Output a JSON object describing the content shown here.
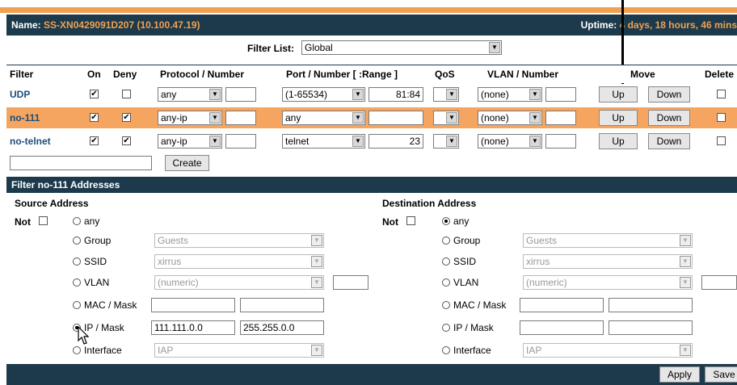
{
  "header": {
    "name_label": "Name:",
    "name_value": "SS-XN0429091D207",
    "ip_value": "(10.100.47.19)",
    "uptime_label": "Uptime:",
    "uptime_value": "4 days, 18 hours, 46 mins"
  },
  "filter_list": {
    "label": "Filter List:",
    "value": "Global"
  },
  "columns": {
    "filter": "Filter",
    "on": "On",
    "deny": "Deny",
    "protocol": "Protocol / Number",
    "port": "Port / Number [ :Range ]",
    "qos": "QoS",
    "vlan": "VLAN / Number",
    "move": "Move",
    "delete": "Delete"
  },
  "rows": [
    {
      "name": "UDP",
      "on": true,
      "deny": false,
      "protocol": "any",
      "protocol_num": "",
      "port": "(1-65534)",
      "port_num": "81:84",
      "qos": "",
      "vlan": "(none)",
      "vlan_num": "",
      "up": "Up",
      "down": "Down",
      "highlight": false
    },
    {
      "name": "no-111",
      "on": true,
      "deny": true,
      "protocol": "any-ip",
      "protocol_num": "",
      "port": "any",
      "port_num": "",
      "qos": "",
      "vlan": "(none)",
      "vlan_num": "",
      "up": "Up",
      "down": "Down",
      "highlight": true
    },
    {
      "name": "no-telnet",
      "on": true,
      "deny": true,
      "protocol": "any-ip",
      "protocol_num": "",
      "port": "telnet",
      "port_num": "23",
      "qos": "",
      "vlan": "(none)",
      "vlan_num": "",
      "up": "Up",
      "down": "Down",
      "highlight": false
    }
  ],
  "create": {
    "value": "",
    "button": "Create"
  },
  "addresses": {
    "title": "Filter no-111  Addresses",
    "source": {
      "heading": "Source Address",
      "not_label": "Not",
      "options": {
        "any": "any",
        "group": "Group",
        "ssid": "SSID",
        "vlan": "VLAN",
        "mac": "MAC / Mask",
        "ip": "IP / Mask",
        "iface": "Interface"
      },
      "selected": "ip",
      "group_value": "Guests",
      "ssid_value": "xirrus",
      "vlan_value": "(numeric)",
      "vlan_num": "",
      "mac_value": "",
      "mac_mask": "",
      "ip_value": "111.111.0.0",
      "ip_mask": "255.255.0.0",
      "iface_value": "IAP"
    },
    "destination": {
      "heading": "Destination Address",
      "not_label": "Not",
      "options": {
        "any": "any",
        "group": "Group",
        "ssid": "SSID",
        "vlan": "VLAN",
        "mac": "MAC / Mask",
        "ip": "IP / Mask",
        "iface": "Interface"
      },
      "selected": "any",
      "group_value": "Guests",
      "ssid_value": "xirrus",
      "vlan_value": "(numeric)",
      "vlan_num": "",
      "mac_value": "",
      "mac_mask": "",
      "ip_value": "",
      "ip_mask": "",
      "iface_value": "IAP"
    }
  },
  "footer": {
    "apply": "Apply",
    "save": "Save"
  },
  "colors": {
    "navy": "#1c3a4c",
    "orange": "#f0a050",
    "highlight_row": "#f5a560"
  }
}
